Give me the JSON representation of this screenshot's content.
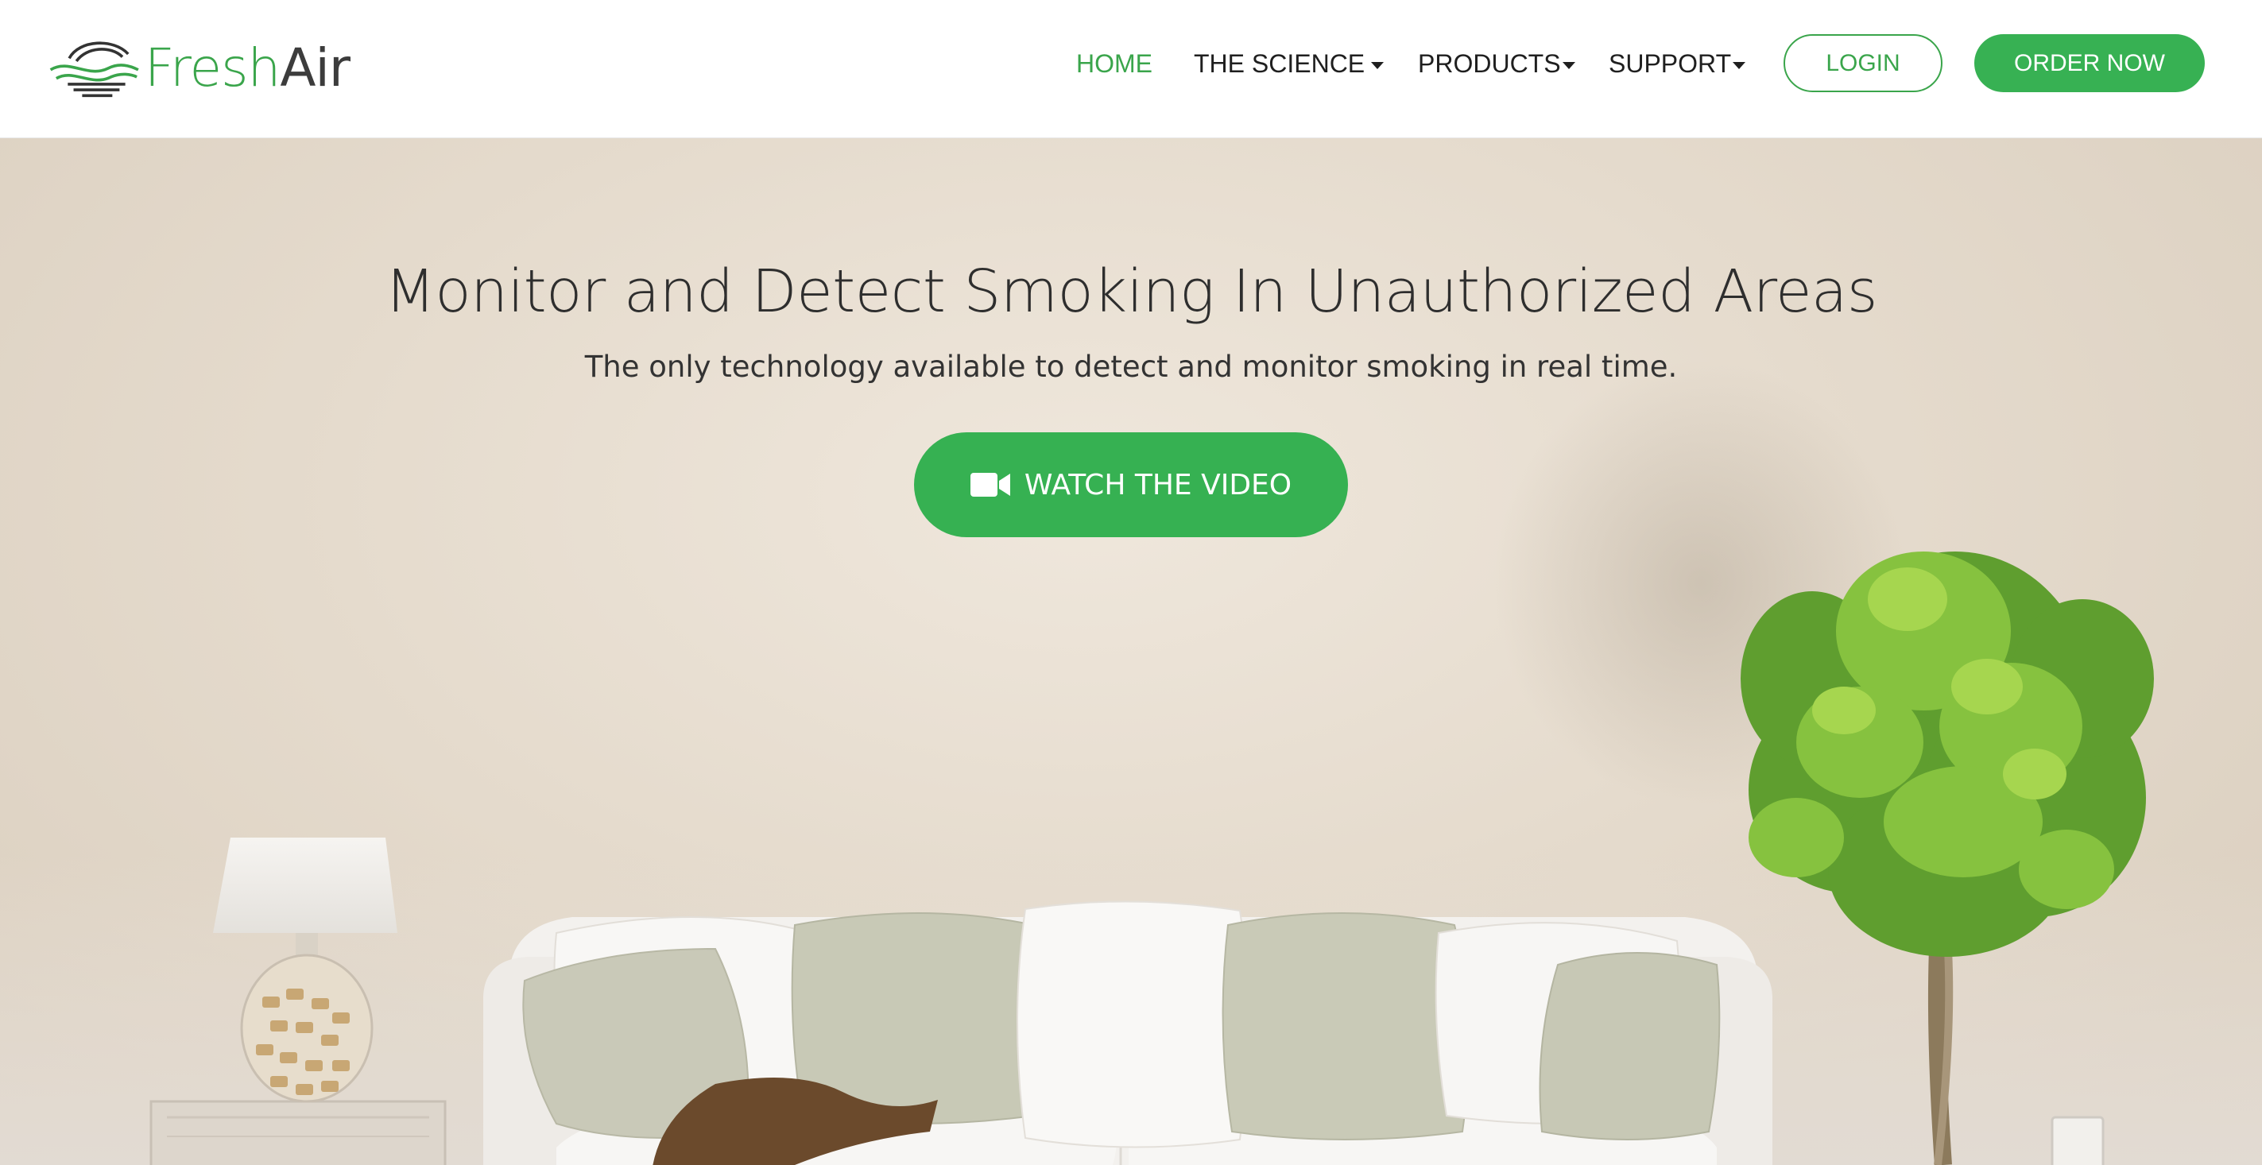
{
  "brand": {
    "fresh": "Fresh",
    "air": "Air"
  },
  "nav": {
    "home": "HOME",
    "science": "THE SCIENCE",
    "products": "PRODUCTS",
    "support": "SUPPORT"
  },
  "actions": {
    "login": "LOGIN",
    "order": "ORDER NOW"
  },
  "hero": {
    "title": "Monitor and Detect Smoking In Unauthorized Areas",
    "subtitle": "The only technology available to detect and monitor smoking in real time.",
    "video_button": "WATCH THE VIDEO"
  },
  "colors": {
    "accent": "#37b153",
    "text": "#2e2e2e"
  }
}
